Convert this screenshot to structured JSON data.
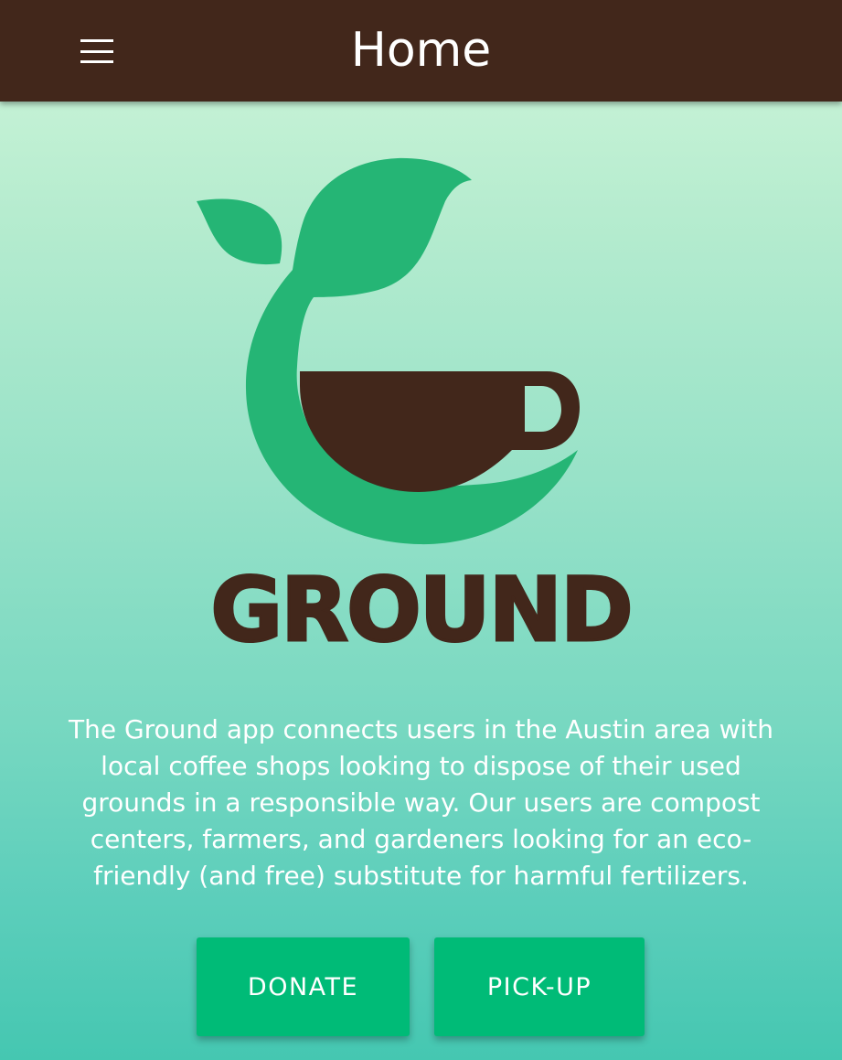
{
  "app_bar": {
    "title": "Home",
    "menu_icon": "hamburger-menu-icon"
  },
  "logo": {
    "icon": "coffee-cup-sprout-logo",
    "brand_name": "GROUND",
    "colors": {
      "leaf_green": "#25b575",
      "cup_brown": "#42271b"
    }
  },
  "description": "The Ground app connects users in the Austin area with local coffee shops looking to dispose of their used grounds in a responsible way. Our users are compost centers, farmers, and gardeners looking for an eco-friendly (and free) substitute for harmful fertilizers.",
  "actions": {
    "donate_label": "DONATE",
    "pickup_label": "PICK-UP"
  },
  "colors": {
    "app_bar": "#42271b",
    "button": "#00bb77",
    "background_top": "#d0f6da",
    "background_bottom": "#45c7b1"
  }
}
